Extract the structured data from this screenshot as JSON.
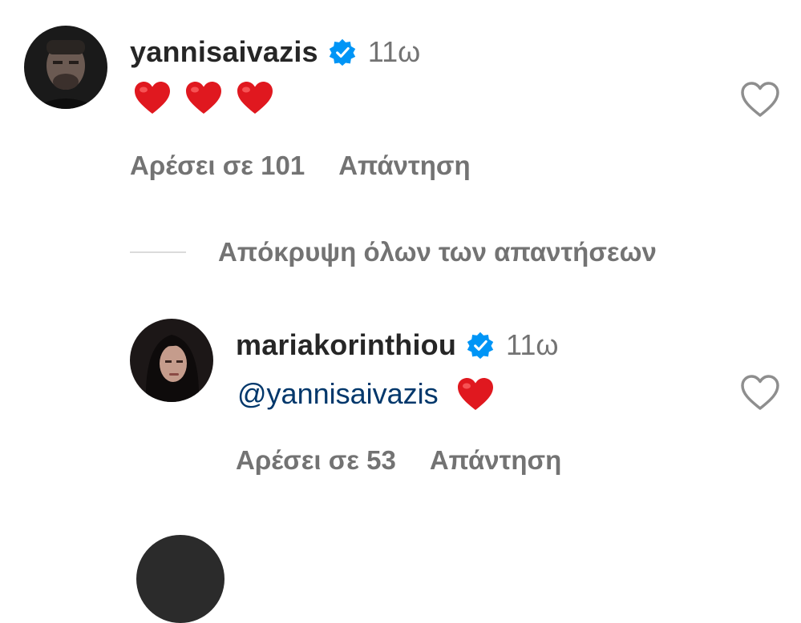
{
  "comments": [
    {
      "username": "yannisaivazis",
      "time": "11ω",
      "text_emojis": [
        "heart-emoji",
        "heart-emoji",
        "heart-emoji"
      ],
      "likes_label": "Αρέσει σε 101",
      "reply_label": "Απάντηση"
    },
    {
      "username": "mariakorinthiou",
      "time": "11ω",
      "mention": "@yannisaivazis",
      "text_emojis": [
        "heart-emoji"
      ],
      "likes_label": "Αρέσει σε 53",
      "reply_label": "Απάντηση"
    }
  ],
  "replies_toggle": {
    "label": "Απόκρυψη όλων των απαντήσεων"
  },
  "colors": {
    "username": "#262626",
    "secondary_text": "#737373",
    "verified_badge": "#0095f6",
    "mention": "#00376b",
    "heart": "#e0181f",
    "divider": "#dbdbdb"
  }
}
